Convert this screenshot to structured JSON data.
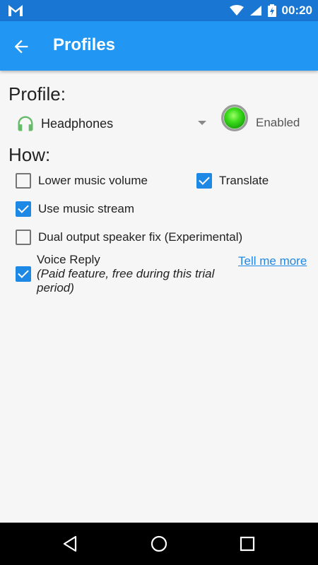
{
  "status_bar": {
    "time": "00:20"
  },
  "app_bar": {
    "title": "Profiles"
  },
  "profile_section": {
    "heading": "Profile:",
    "selected_profile": "Headphones",
    "enabled_label": "Enabled"
  },
  "how_section": {
    "heading": "How:",
    "options": [
      {
        "label": "Lower music volume",
        "checked": false
      },
      {
        "label": "Translate",
        "checked": true
      },
      {
        "label": "Use music stream",
        "checked": true
      },
      {
        "label": "Dual output speaker fix (Experimental)",
        "checked": false
      }
    ],
    "voice_reply": {
      "label": "Voice Reply",
      "note": "(Paid feature, free during this trial period)",
      "checked": true,
      "link": "Tell me more"
    }
  },
  "colors": {
    "status_bar": "#1976d2",
    "app_bar": "#2196f3",
    "accent": "#1e88e5",
    "led": "#3ddc1c"
  }
}
